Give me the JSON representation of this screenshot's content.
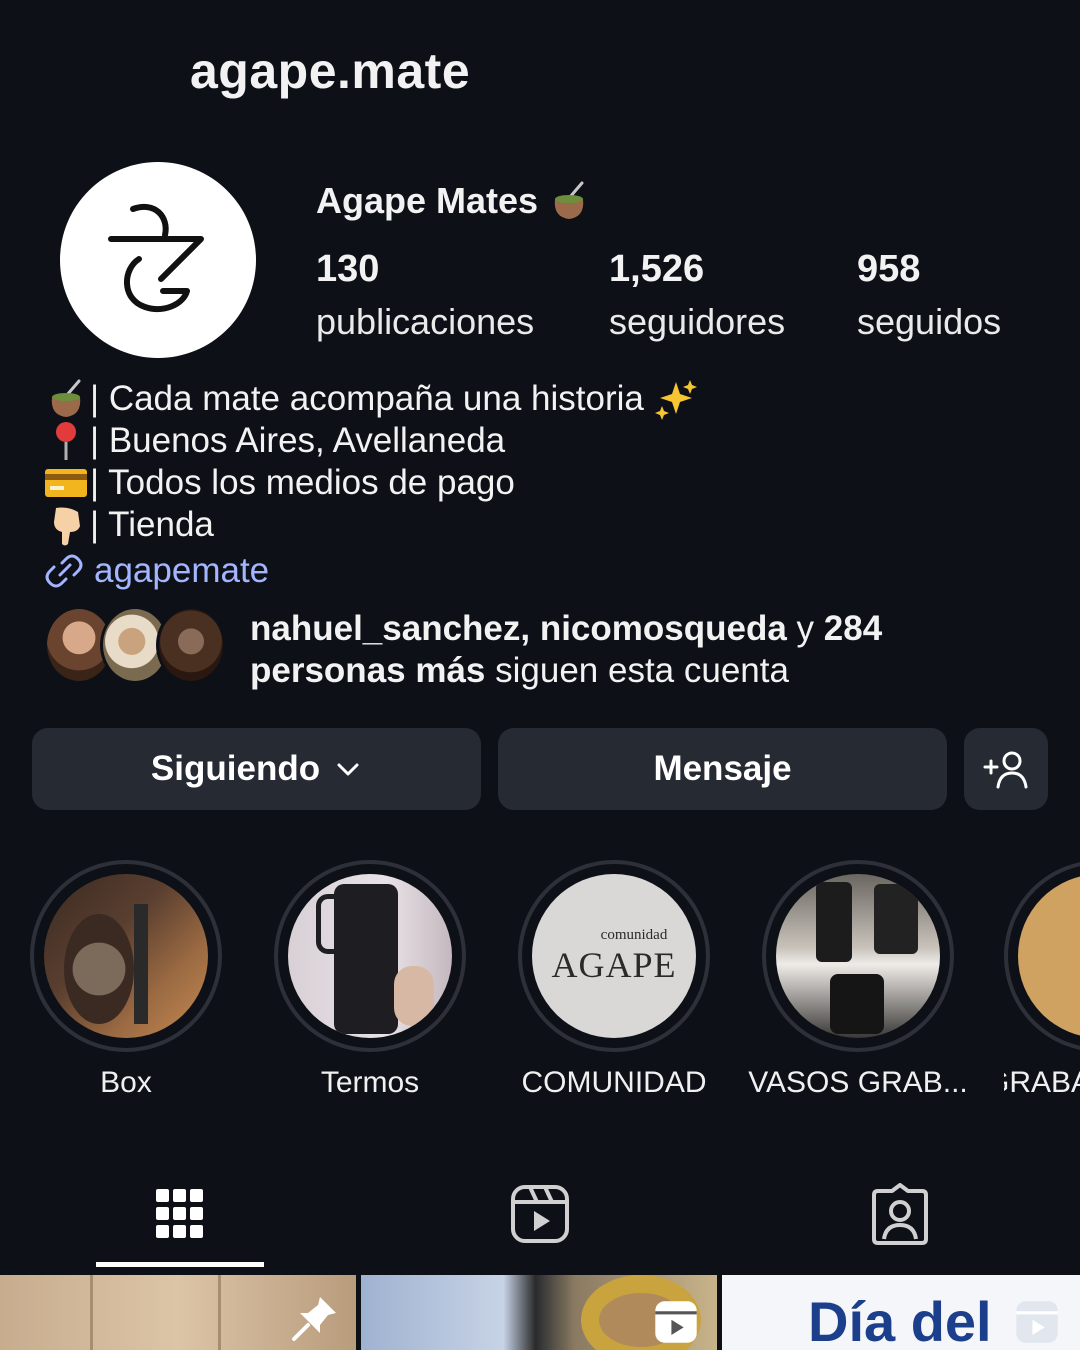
{
  "profile": {
    "username": "agape.mate",
    "display_name": "Agape Mates",
    "stats": [
      {
        "value": "130",
        "label": "publicaciones"
      },
      {
        "value": "1,526",
        "label": "seguidores"
      },
      {
        "value": "958",
        "label": "seguidos"
      }
    ]
  },
  "bio": {
    "lines": [
      {
        "icon": "mate-icon",
        "text": "| Cada mate acompaña una historia"
      },
      {
        "icon": "pin-icon",
        "text": "| Buenos Aires, Avellaneda"
      },
      {
        "icon": "card-icon",
        "text": " | Todos los medios de pago"
      },
      {
        "icon": "point-down-icon",
        "text": " | Tienda"
      }
    ],
    "link_text": "agapemate"
  },
  "followed_by": {
    "names": "nahuel_sanchez, nicomosqueda",
    "y": " y ",
    "count": "284",
    "bold_tail": "personas más",
    "rest": " siguen esta cuenta"
  },
  "actions": {
    "following_label": "Siguiendo",
    "message_label": "Mensaje"
  },
  "highlights": [
    {
      "label": "Box"
    },
    {
      "label": "Termos"
    },
    {
      "label": "COMUNIDAD",
      "cover_small": "comunidad",
      "cover_big": "AGAPE"
    },
    {
      "label": "VASOS GRAB..."
    },
    {
      "label": "GRABA"
    }
  ],
  "grid": {
    "tile4_text": "Día del"
  },
  "colors": {
    "background": "#0d1117",
    "button": "#262a33",
    "link": "#a4b5ff"
  }
}
